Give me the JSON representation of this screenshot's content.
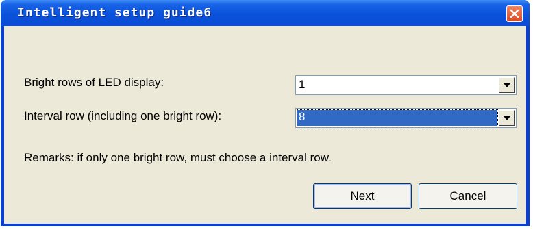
{
  "window": {
    "title": "Intelligent setup guide6",
    "close_icon": "close-icon"
  },
  "form": {
    "bright_rows_label": "Bright rows of LED display:",
    "bright_rows_value": "1",
    "interval_row_label": "Interval row (including one bright row):",
    "interval_row_value": "8",
    "remarks": "Remarks: if only one bright row, must choose a interval row."
  },
  "buttons": {
    "next_label": "Next",
    "cancel_label": "Cancel"
  },
  "colors": {
    "titlebar": "#0a52db",
    "selection": "#316ac5",
    "dialog_bg": "#ece9d8"
  }
}
